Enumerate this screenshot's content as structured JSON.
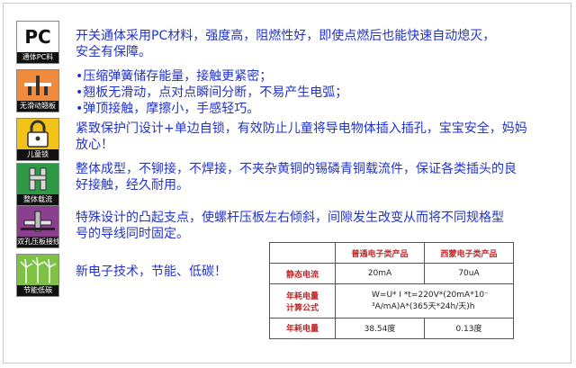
{
  "features": [
    {
      "icon_name": "pc-material-icon",
      "icon_title": "PC",
      "icon_caption": "通体PC料",
      "lines": [
        "开关通体采用PC材料，强度高，阻燃性好，即使点燃后也能快速自动熄灭，",
        "安全有保障。"
      ]
    },
    {
      "icon_name": "no-slip-icon",
      "icon_caption": "无滑动翘板",
      "lines": [
        "•压缩弹簧储存能量，接触更紧密；",
        "•翘板无滑动，点对点瞬间分断，不易产生电弧；",
        "•弹顶接触，摩擦小，手感轻巧。"
      ]
    },
    {
      "icon_name": "child-lock-icon",
      "icon_caption": "儿童锁",
      "lines": [
        "紧致保护门设计+单边自锁，有效防止儿童将导电物体插入插孔，宝宝安全，妈妈",
        "放心！"
      ]
    },
    {
      "icon_name": "integral-carrier-icon",
      "icon_caption": "整体载流",
      "lines": [
        "整体成型，不铆接，不焊接，不夹杂黄铜的锡磷青铜载流件，保证各类插头的良",
        "好接触，经久耐用。"
      ]
    },
    {
      "icon_name": "double-hole-clamp-icon",
      "icon_caption": "双孔压板接线",
      "lines": [
        "特殊设计的凸起支点，使螺杆压板左右倾斜，间隙发生改变从而将不同规格型",
        "号的导线同时固定。"
      ]
    },
    {
      "icon_name": "energy-saving-icon",
      "icon_caption": "节能低碳",
      "lines": [
        "新电子技术，节能、低碳！"
      ]
    }
  ],
  "table": {
    "headers": [
      "",
      "普通电子类产品",
      "西蒙电子类产品"
    ],
    "rows": [
      {
        "label": "静态电流",
        "c1": "20mA",
        "c2": "70uA"
      },
      {
        "label_lines": [
          "年耗电量",
          "计算公式"
        ],
        "formula_lines": [
          "W=U* I *t=220V*(20mA*10⁻",
          "³A/mA)A*(365天*24h/天)h"
        ]
      },
      {
        "label": "年耗电量",
        "c1": "38.54度",
        "c2": "0.13度"
      }
    ]
  },
  "colors": {
    "text": "#2233cc",
    "table_header": "#c0282a",
    "icon_cap": "#111111"
  }
}
